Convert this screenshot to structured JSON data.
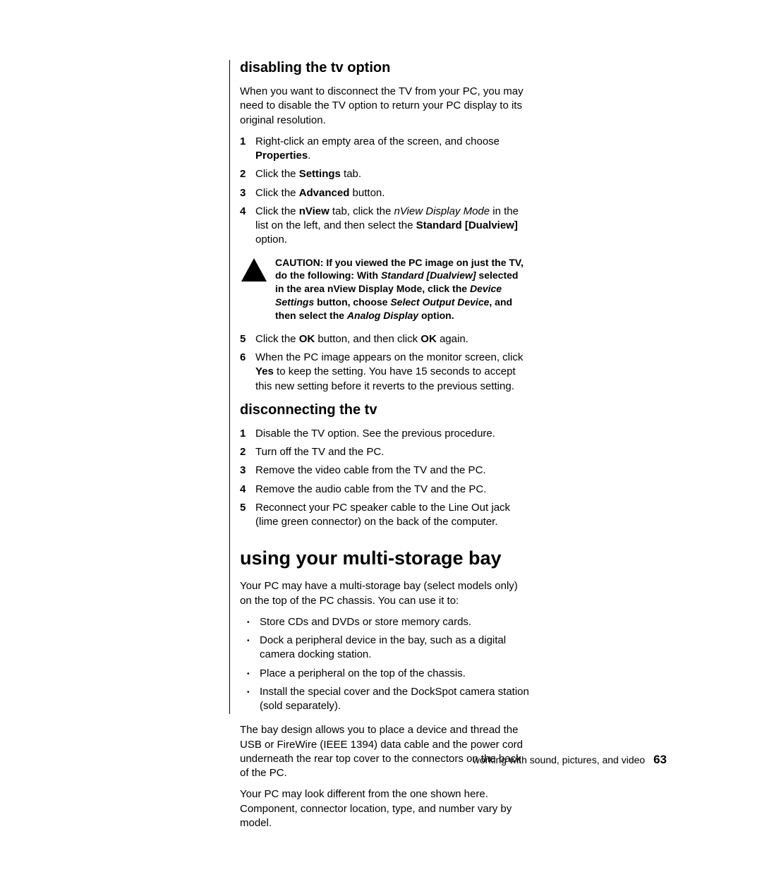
{
  "section1": {
    "title": "disabling the tv option",
    "intro": "When you want to disconnect the TV from your PC, you may need to disable the TV option to return your PC display to its original resolution.",
    "steps_a": [
      {
        "n": "1",
        "pre": "Right-click an empty area of the screen, and choose ",
        "b1": "Properties",
        "post": "."
      },
      {
        "n": "2",
        "pre": "Click the ",
        "b1": "Settings",
        "post": " tab."
      },
      {
        "n": "3",
        "pre": "Click the ",
        "b1": "Advanced",
        "post": " button."
      },
      {
        "n": "4",
        "pre": "Click the ",
        "b1": "nView",
        "mid1": " tab, click the ",
        "i1": "nView Display Mode",
        "mid2": " in the list on the left, and then select the ",
        "b2": "Standard [Dualview]",
        "post": " option."
      }
    ],
    "caution": {
      "t1": "CAUTION: If you viewed the PC image on just the TV, do the following: With ",
      "bi1": "Standard [Dualview]",
      "t2": " selected in the area nView Display Mode, click the ",
      "bi2": "Device Settings",
      "t3": " button, choose ",
      "bi3": "Select Output Device",
      "t4": ", and then select the ",
      "bi4": "Analog Display",
      "t5": " option."
    },
    "steps_b": [
      {
        "n": "5",
        "pre": "Click the ",
        "b1": "OK",
        "mid": " button, and then click ",
        "b2": "OK",
        "post": " again."
      },
      {
        "n": "6",
        "pre": "When the PC image appears on the monitor screen, click ",
        "b1": "Yes",
        "post": " to keep the setting. You have 15 seconds to accept this new setting before it reverts to the previous setting."
      }
    ]
  },
  "section2": {
    "title": "disconnecting the tv",
    "steps": [
      {
        "n": "1",
        "t": "Disable the TV option. See the previous procedure."
      },
      {
        "n": "2",
        "t": "Turn off the TV and the PC."
      },
      {
        "n": "3",
        "t": "Remove the video cable from the TV and the PC."
      },
      {
        "n": "4",
        "t": "Remove the audio cable from the TV and the PC."
      },
      {
        "n": "5",
        "t": "Reconnect your PC speaker cable to the Line Out jack (lime green connector) on the back of the computer."
      }
    ]
  },
  "section3": {
    "title": "using your multi-storage bay",
    "intro": "Your PC may have a multi-storage bay (select models only) on the top of the PC chassis. You can use it to:",
    "bullets": [
      "Store CDs and DVDs or store memory cards.",
      "Dock a peripheral device in the bay, such as a digital camera docking station.",
      "Place a peripheral on the top of the chassis.",
      "Install the special cover and the DockSpot camera station (sold separately)."
    ],
    "para1": "The bay design allows you to place a device and thread the USB or FireWire (IEEE 1394) data cable and the power cord underneath the rear top cover to the connectors on the back of the PC.",
    "para2": "Your PC may look different from the one shown here. Component, connector location, type, and number vary by model."
  },
  "footer": {
    "text": "working with sound, pictures, and video",
    "page": "63"
  }
}
